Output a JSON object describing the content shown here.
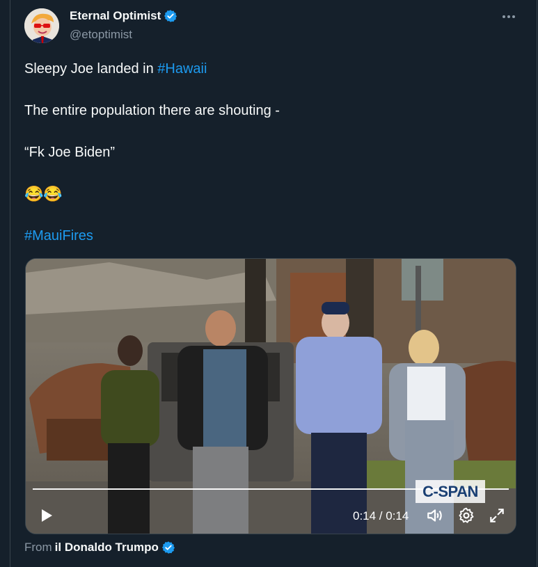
{
  "tweet": {
    "author_name": "Eternal Optimist",
    "author_handle": "@etoptimist",
    "line1_prefix": "Sleepy Joe landed in ",
    "line1_hashtag": "#Hawaii",
    "line2": "The entire population there are shouting -",
    "line3": "“Fk Joe Biden”",
    "emojis": "😂😂",
    "hashtag2": "#MauiFires"
  },
  "video": {
    "time_display": "0:14 / 0:14",
    "watermark": "C-SPAN",
    "progress": 1.0
  },
  "source": {
    "prefix": "From",
    "name": "il Donaldo Trumpo"
  },
  "colors": {
    "background": "#15202b",
    "link": "#1d9bf0",
    "verified": "#1d9bf0",
    "secondary_text": "#8b98a5"
  },
  "icons": [
    "verified-badge-icon",
    "more-options-icon",
    "play-icon",
    "volume-icon",
    "settings-gear-icon",
    "fullscreen-icon"
  ]
}
